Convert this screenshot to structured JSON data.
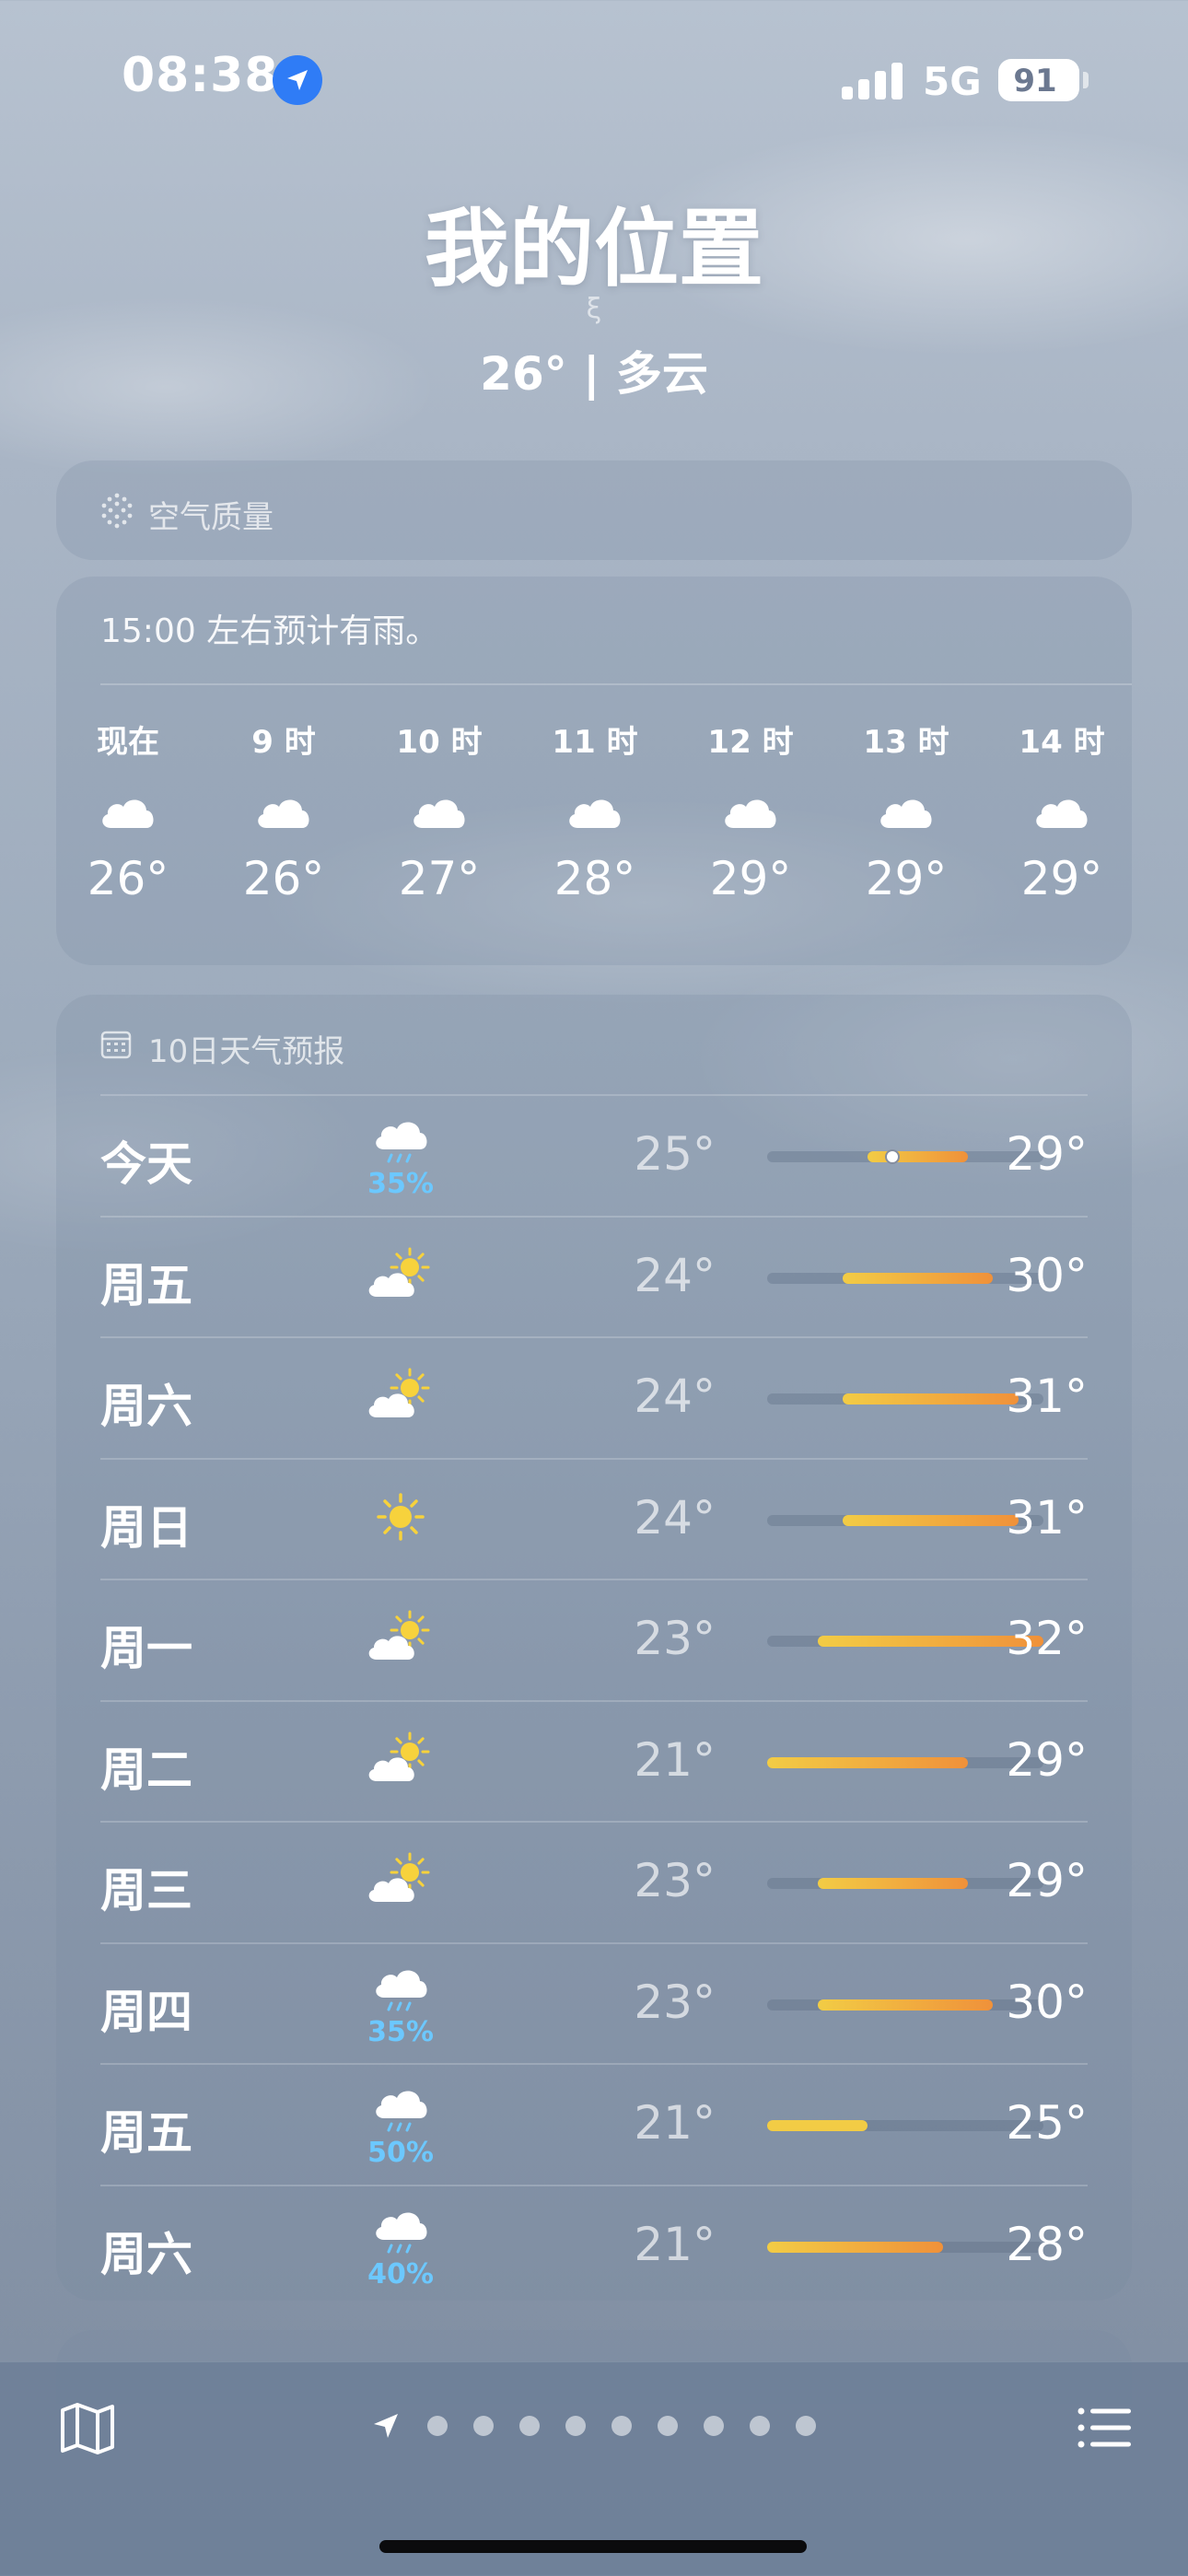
{
  "status_bar": {
    "time": "08:38",
    "network": "5G",
    "battery": "91"
  },
  "header": {
    "location": "我的位置",
    "subtitle_mark": "ξ",
    "current": "26° | 多云"
  },
  "air_quality": {
    "title": "空气质量"
  },
  "hourly": {
    "note": "15:00 左右预计有雨。",
    "hours": [
      {
        "label": "现在",
        "icon": "cloud-icon",
        "temp": "26°"
      },
      {
        "label": "9 时",
        "icon": "cloud-icon",
        "temp": "26°"
      },
      {
        "label": "10 时",
        "icon": "cloud-icon",
        "temp": "27°"
      },
      {
        "label": "11 时",
        "icon": "cloud-icon",
        "temp": "28°"
      },
      {
        "label": "12 时",
        "icon": "cloud-icon",
        "temp": "29°"
      },
      {
        "label": "13 时",
        "icon": "cloud-icon",
        "temp": "29°"
      },
      {
        "label": "14 时",
        "icon": "cloud-icon",
        "temp": "29°"
      }
    ]
  },
  "daily": {
    "title": "10日天气预报",
    "range_min": 21,
    "range_max": 32,
    "current_temp": 26,
    "days": [
      {
        "name": "今天",
        "icon": "rain-cloud-icon",
        "pop": "35%",
        "low": "25°",
        "high": "29°",
        "low_value": 25,
        "high_value": 29
      },
      {
        "name": "周五",
        "icon": "partly-cloudy-icon",
        "pop": "",
        "low": "24°",
        "high": "30°",
        "low_value": 24,
        "high_value": 30
      },
      {
        "name": "周六",
        "icon": "partly-cloudy-icon",
        "pop": "",
        "low": "24°",
        "high": "31°",
        "low_value": 24,
        "high_value": 31
      },
      {
        "name": "周日",
        "icon": "sun-icon",
        "pop": "",
        "low": "24°",
        "high": "31°",
        "low_value": 24,
        "high_value": 31
      },
      {
        "name": "周一",
        "icon": "partly-cloudy-icon",
        "pop": "",
        "low": "23°",
        "high": "32°",
        "low_value": 23,
        "high_value": 32
      },
      {
        "name": "周二",
        "icon": "partly-cloudy-icon",
        "pop": "",
        "low": "21°",
        "high": "29°",
        "low_value": 21,
        "high_value": 29
      },
      {
        "name": "周三",
        "icon": "partly-cloudy-icon",
        "pop": "",
        "low": "23°",
        "high": "29°",
        "low_value": 23,
        "high_value": 29
      },
      {
        "name": "周四",
        "icon": "rain-cloud-icon",
        "pop": "35%",
        "low": "23°",
        "high": "30°",
        "low_value": 23,
        "high_value": 30
      },
      {
        "name": "周五",
        "icon": "rain-cloud-icon",
        "pop": "50%",
        "low": "21°",
        "high": "25°",
        "low_value": 21,
        "high_value": 25
      },
      {
        "name": "周六",
        "icon": "rain-cloud-icon",
        "pop": "40%",
        "low": "21°",
        "high": "28°",
        "low_value": 21,
        "high_value": 28
      }
    ]
  },
  "bottom_bar": {
    "map_icon": "map-icon",
    "list_icon": "list-icon",
    "page_count": 9,
    "current_page_icon": "location-arrow-icon"
  },
  "colors": {
    "accent_blue": "#2f7cf6",
    "pop_blue": "#6cc8ff",
    "bar_yellow": "#f2cc45",
    "bar_orange": "#f0913a",
    "sun": "#f7d23c"
  }
}
